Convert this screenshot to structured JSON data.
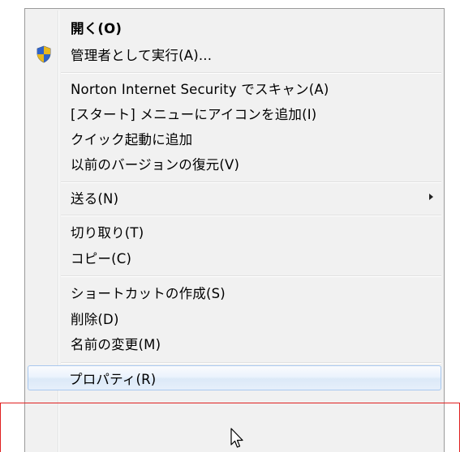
{
  "context_menu": {
    "items": [
      {
        "label": "開く(O)",
        "bold": true
      },
      {
        "label": "管理者として実行(A)...",
        "icon": "uac-shield-icon"
      },
      {
        "label": "Norton Internet Security でスキャン(A)"
      },
      {
        "label": "[スタート] メニューにアイコンを追加(I)"
      },
      {
        "label": "クイック起動に追加"
      },
      {
        "label": "以前のバージョンの復元(V)"
      },
      {
        "label": "送る(N)",
        "submenu": true
      },
      {
        "label": "切り取り(T)"
      },
      {
        "label": "コピー(C)"
      },
      {
        "label": "ショートカットの作成(S)"
      },
      {
        "label": "削除(D)"
      },
      {
        "label": "名前の変更(M)"
      },
      {
        "label": "プロパティ(R)",
        "highlighted": true
      }
    ]
  },
  "colors": {
    "menu_background": "#f1f1f1",
    "highlight_border": "#a8c8ef",
    "annotation_frame": "#e02020"
  },
  "cursor": "arrow-pointer-icon"
}
